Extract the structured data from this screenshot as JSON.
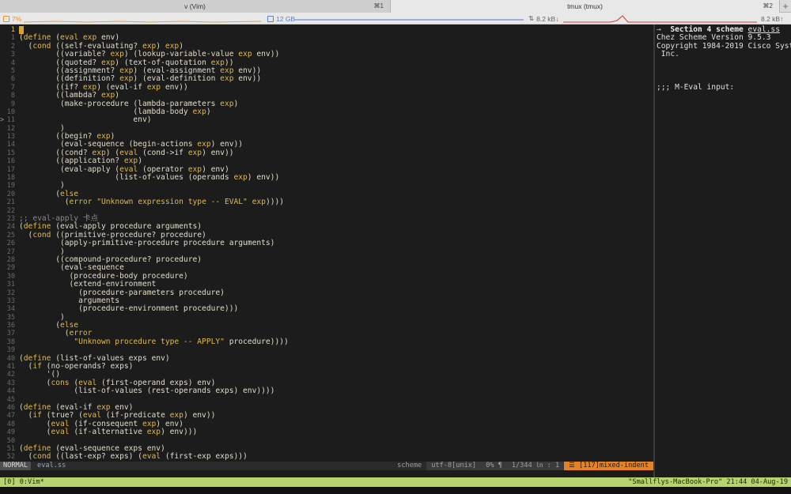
{
  "tabs": [
    {
      "label": "v (Vim)",
      "shortcut": "⌘1"
    },
    {
      "label": "tmux (tmux)",
      "shortcut": "⌘2"
    }
  ],
  "tab_new_label": "+",
  "status": {
    "cpu": "7%",
    "mem": "12 GB",
    "net_down": "8.2 kB↓",
    "net_up": "8.2 kB↑"
  },
  "editor": {
    "current_line": "1",
    "lines": [
      {
        "n": "1",
        "s": "",
        "t": ""
      },
      {
        "n": "1",
        "s": "",
        "t": "(define (eval exp env)"
      },
      {
        "n": "2",
        "s": "",
        "t": "  (cond ((self-evaluating? exp) exp)"
      },
      {
        "n": "3",
        "s": "",
        "t": "        ((variable? exp) (lookup-variable-value exp env))"
      },
      {
        "n": "4",
        "s": "",
        "t": "        ((quoted? exp) (text-of-quotation exp))"
      },
      {
        "n": "5",
        "s": "",
        "t": "        ((assignment? exp) (eval-assignment exp env))"
      },
      {
        "n": "6",
        "s": "",
        "t": "        ((definition? exp) (eval-definition exp env))"
      },
      {
        "n": "7",
        "s": "",
        "t": "        ((if? exp) (eval-if exp env))"
      },
      {
        "n": "8",
        "s": "",
        "t": "        ((lambda? exp)"
      },
      {
        "n": "9",
        "s": "",
        "t": "         (make-procedure (lambda-parameters exp)"
      },
      {
        "n": "10",
        "s": "",
        "t": "                         (lambda-body exp)"
      },
      {
        "n": "11",
        "s": ">",
        "t": "                         env)"
      },
      {
        "n": "12",
        "s": "",
        "t": "         )"
      },
      {
        "n": "13",
        "s": "",
        "t": "        ((begin? exp)"
      },
      {
        "n": "14",
        "s": "",
        "t": "         (eval-sequence (begin-actions exp) env))"
      },
      {
        "n": "15",
        "s": "",
        "t": "        ((cond? exp) (eval (cond->if exp) env))"
      },
      {
        "n": "16",
        "s": "",
        "t": "        ((application? exp)"
      },
      {
        "n": "17",
        "s": "",
        "t": "         (eval-apply (eval (operator exp) env)"
      },
      {
        "n": "18",
        "s": "",
        "t": "                     (list-of-values (operands exp) env))"
      },
      {
        "n": "19",
        "s": "",
        "t": "         )"
      },
      {
        "n": "20",
        "s": "",
        "t": "        (else"
      },
      {
        "n": "21",
        "s": "",
        "t": "          (error \"Unknown expression type -- EVAL\" exp))))"
      },
      {
        "n": "22",
        "s": "",
        "t": ""
      },
      {
        "n": "23",
        "s": "",
        "t": ";; eval-apply 卡点"
      },
      {
        "n": "24",
        "s": "",
        "t": "(define (eval-apply procedure arguments)"
      },
      {
        "n": "25",
        "s": "",
        "t": "  (cond ((primitive-procedure? procedure)"
      },
      {
        "n": "26",
        "s": "",
        "t": "         (apply-primitive-procedure procedure arguments)"
      },
      {
        "n": "27",
        "s": "",
        "t": "         )"
      },
      {
        "n": "28",
        "s": "",
        "t": "        ((compound-procedure? procedure)"
      },
      {
        "n": "29",
        "s": "",
        "t": "         (eval-sequence"
      },
      {
        "n": "30",
        "s": "",
        "t": "           (procedure-body procedure)"
      },
      {
        "n": "31",
        "s": "",
        "t": "           (extend-environment"
      },
      {
        "n": "32",
        "s": "",
        "t": "             (procedure-parameters procedure)"
      },
      {
        "n": "33",
        "s": "",
        "t": "             arguments"
      },
      {
        "n": "34",
        "s": "",
        "t": "             (procedure-environment procedure)))"
      },
      {
        "n": "35",
        "s": "",
        "t": "         )"
      },
      {
        "n": "36",
        "s": "",
        "t": "        (else"
      },
      {
        "n": "37",
        "s": "",
        "t": "          (error"
      },
      {
        "n": "38",
        "s": "",
        "t": "            \"Unknown procedure type -- APPLY\" procedure))))"
      },
      {
        "n": "39",
        "s": "",
        "t": ""
      },
      {
        "n": "40",
        "s": "",
        "t": "(define (list-of-values exps env)"
      },
      {
        "n": "41",
        "s": "",
        "t": "  (if (no-operands? exps)"
      },
      {
        "n": "42",
        "s": "",
        "t": "      '()"
      },
      {
        "n": "43",
        "s": "",
        "t": "      (cons (eval (first-operand exps) env)"
      },
      {
        "n": "44",
        "s": "",
        "t": "            (list-of-values (rest-operands exps) env))))"
      },
      {
        "n": "45",
        "s": "",
        "t": ""
      },
      {
        "n": "46",
        "s": "",
        "t": "(define (eval-if exp env)"
      },
      {
        "n": "47",
        "s": "",
        "t": "  (if (true? (eval (if-predicate exp) env))"
      },
      {
        "n": "48",
        "s": "",
        "t": "      (eval (if-consequent exp) env)"
      },
      {
        "n": "49",
        "s": "",
        "t": "      (eval (if-alternative exp) env)))"
      },
      {
        "n": "50",
        "s": "",
        "t": ""
      },
      {
        "n": "51",
        "s": "",
        "t": "(define (eval-sequence exps env)"
      },
      {
        "n": "52",
        "s": "",
        "t": "  (cond ((last-exp? exps) (eval (first-exp exps)))"
      }
    ]
  },
  "vim_status": {
    "mode": "NORMAL",
    "file": "eval.ss",
    "filetype": "scheme",
    "encoding": "utf-8[unix]",
    "percent": "0% ¶",
    "position": "1/344 ㏑ :  1",
    "warning": "☰ [117]mixed-indent"
  },
  "repl": {
    "arrow": "→",
    "section": "Section 4",
    "lang": "scheme",
    "file": "eval.ss",
    "lines": [
      "Chez Scheme Version 9.5.3",
      "Copyright 1984-2019 Cisco Systems,",
      " Inc.",
      "",
      "",
      "",
      ";;; M-Eval input:"
    ]
  },
  "tmux": {
    "left": "[0] 0:Vim*",
    "right": "\"Smallflys-MacBook-Pro\" 21:44 04-Aug-19"
  },
  "colors": {
    "keyword": "#e1b94a",
    "string": "#e1b94a",
    "comment": "#8a8a8a",
    "tmux_bg": "#b6d36f",
    "warn_bg": "#e58226"
  }
}
